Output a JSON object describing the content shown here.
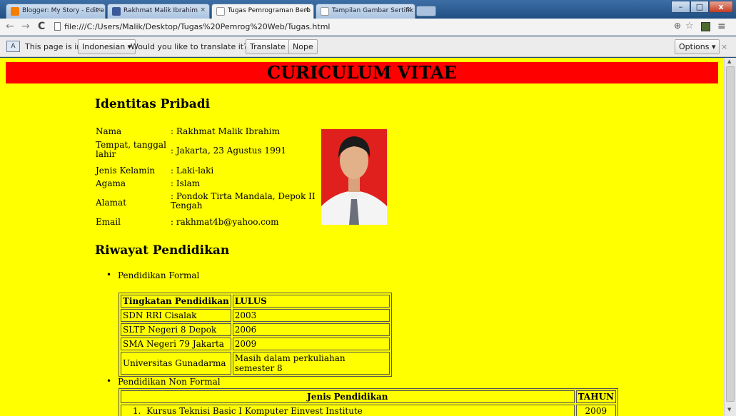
{
  "browser": {
    "tabs": [
      {
        "label": "Blogger: My Story - Edit e",
        "favicon_color": "#f57d00"
      },
      {
        "label": "Rakhmat Malik Ibrahim",
        "favicon_color": "#3b5998"
      },
      {
        "label": "Tugas Pemrograman Berb",
        "favicon_color": "#ffffff"
      },
      {
        "label": "Tampilan Gambar Sertifik",
        "favicon_color": "#ffffff"
      }
    ],
    "tab_close_glyph": "×",
    "url": "file:///C:/Users/Malik/Desktop/Tugas%20Pemrog%20Web/Tugas.html",
    "translate_bar": {
      "prefix": "This page is in",
      "language": "Indonesian",
      "question": "Would you like to translate it?",
      "translate_btn": "Translate",
      "nope_btn": "Nope",
      "options_btn": "Options",
      "close_glyph": "×"
    }
  },
  "page": {
    "background": "#ffff00",
    "banner_color": "#ff0000",
    "title": "CURICULUM VITAE",
    "section1": "Identitas Pribadi",
    "identity": [
      {
        "label": "Nama",
        "value": ": Rakhmat Malik Ibrahim"
      },
      {
        "label": "Tempat, tanggal lahir",
        "value": ": Jakarta, 23 Agustus 1991"
      },
      {
        "label": "Jenis Kelamin",
        "value": ": Laki-laki"
      },
      {
        "label": "Agama",
        "value": ": Islam"
      },
      {
        "label": "Alamat",
        "value": ": Pondok Tirta Mandala, Depok II Tengah"
      },
      {
        "label": "Email",
        "value": ": rakhmat4b@yahoo.com"
      }
    ],
    "section2": "Riwayat Pendidikan",
    "formal_label": "Pendidikan Formal",
    "formal_headers": [
      "Tingkatan Pendidikan",
      "LULUS"
    ],
    "formal_rows": [
      [
        "SDN RRI Cisalak",
        "2003"
      ],
      [
        "SLTP Negeri 8 Depok",
        "2006"
      ],
      [
        "SMA Negeri 79 Jakarta",
        "2009"
      ],
      [
        "Universitas Gunadarma",
        "Masih dalam perkuliahan semester 8"
      ]
    ],
    "nonformal_label": "Pendidikan Non Formal",
    "nonformal_headers": [
      "Jenis Pendidikan",
      "TAHUN"
    ],
    "nonformal_rows": [
      [
        "1.  Kursus Teknisi Basic I Komputer Einvest Institute",
        "2009"
      ]
    ]
  }
}
